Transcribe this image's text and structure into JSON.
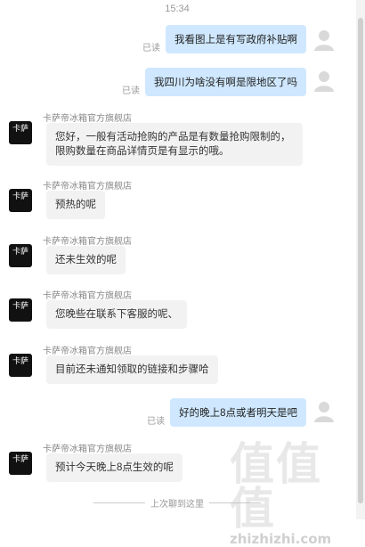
{
  "chat": {
    "timestamp": "15:34",
    "outgoing": [
      {
        "text": "我看图上是有写政府补贴啊",
        "status": "已读"
      },
      {
        "text": "我四川为啥没有啊是限地区了吗",
        "status": "已读"
      },
      {
        "text": "好的晚上8点或者明天是吧",
        "status": "已读"
      }
    ],
    "incoming": [
      {
        "sender": "卡萨帝冰箱官方旗舰店",
        "text": "您好，一般有活动抢购的产品是有数量抢购限制的，限购数量在商品详情页是有显示的哦。"
      },
      {
        "sender": "卡萨帝冰箱官方旗舰店",
        "text": "预热的呢"
      },
      {
        "sender": "卡萨帝冰箱官方旗舰店",
        "text": "还未生效的呢"
      },
      {
        "sender": "卡萨帝冰箱官方旗舰店",
        "text": "您晚些在联系下客服的呢、"
      },
      {
        "sender": "卡萨帝冰箱官方旗舰店",
        "text": "目前还未通知领取的链接和步骤哈"
      },
      {
        "sender": "卡萨帝冰箱官方旗舰店",
        "text": "预计今天晚上8点生效的呢"
      }
    ],
    "shop_avatar_text": "卡萨",
    "history_divider": "上次聊到这里"
  },
  "watermark": {
    "glyphs": "值值值",
    "site": "zhizhizhi.com"
  },
  "icons": {
    "user_avatar": "user-silhouette-icon",
    "shop_avatar": "shop-logo-icon"
  },
  "colors": {
    "outgoing_bubble": "#cfe8ff",
    "incoming_bubble": "#f2f2f2",
    "shop_avatar_bg": "#111111"
  }
}
